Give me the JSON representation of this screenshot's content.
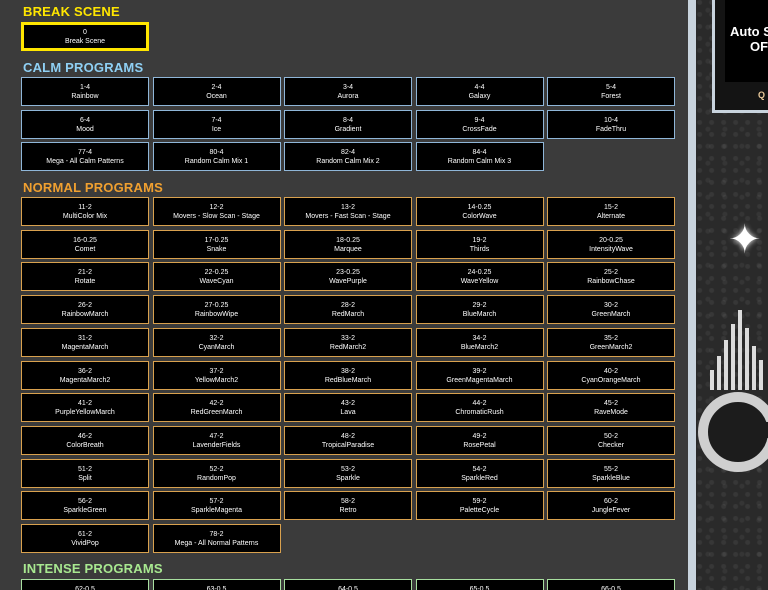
{
  "break_scene": {
    "title": "BREAK SCENE",
    "title_color": "#ffe600",
    "button": {
      "num": "0",
      "name": "Break Scene"
    }
  },
  "calm": {
    "title": "CALM PROGRAMS",
    "title_color": "#8fd0f4",
    "border_color": "#8fb6d8",
    "items": [
      {
        "num": "1-4",
        "name": "Rainbow"
      },
      {
        "num": "2-4",
        "name": "Ocean"
      },
      {
        "num": "3-4",
        "name": "Aurora"
      },
      {
        "num": "4-4",
        "name": "Galaxy"
      },
      {
        "num": "5-4",
        "name": "Forest"
      },
      {
        "num": "6-4",
        "name": "Mood"
      },
      {
        "num": "7-4",
        "name": "Ice"
      },
      {
        "num": "8-4",
        "name": "Gradient"
      },
      {
        "num": "9-4",
        "name": "CrossFade"
      },
      {
        "num": "10-4",
        "name": "FadeThru"
      },
      {
        "num": "77-4",
        "name": "Mega - All Calm Patterns"
      },
      {
        "num": "80-4",
        "name": "Random Calm Mix 1"
      },
      {
        "num": "82-4",
        "name": "Random Calm Mix 2"
      },
      {
        "num": "84-4",
        "name": "Random Calm Mix 3"
      }
    ]
  },
  "normal": {
    "title": "NORMAL PROGRAMS",
    "title_color": "#f0a030",
    "border_color": "#d9a14e",
    "items": [
      {
        "num": "11-2",
        "name": "MultiColor Mix"
      },
      {
        "num": "12-2",
        "name": "Movers - Slow Scan - Stage"
      },
      {
        "num": "13-2",
        "name": "Movers - Fast Scan - Stage"
      },
      {
        "num": "14-0.25",
        "name": "ColorWave"
      },
      {
        "num": "15-2",
        "name": "Alternate"
      },
      {
        "num": "16-0.25",
        "name": "Comet"
      },
      {
        "num": "17-0.25",
        "name": "Snake"
      },
      {
        "num": "18-0.25",
        "name": "Marquee"
      },
      {
        "num": "19-2",
        "name": "Thirds"
      },
      {
        "num": "20-0.25",
        "name": "IntensityWave"
      },
      {
        "num": "21-2",
        "name": "Rotate"
      },
      {
        "num": "22-0.25",
        "name": "WaveCyan"
      },
      {
        "num": "23-0.25",
        "name": "WavePurple"
      },
      {
        "num": "24-0.25",
        "name": "WaveYellow"
      },
      {
        "num": "25-2",
        "name": "RainbowChase"
      },
      {
        "num": "26-2",
        "name": "RainbowMarch"
      },
      {
        "num": "27-0.25",
        "name": "RainbowWipe"
      },
      {
        "num": "28-2",
        "name": "RedMarch"
      },
      {
        "num": "29-2",
        "name": "BlueMarch"
      },
      {
        "num": "30-2",
        "name": "GreenMarch"
      },
      {
        "num": "31-2",
        "name": "MagentaMarch"
      },
      {
        "num": "32-2",
        "name": "CyanMarch"
      },
      {
        "num": "33-2",
        "name": "RedMarch2"
      },
      {
        "num": "34-2",
        "name": "BlueMarch2"
      },
      {
        "num": "35-2",
        "name": "GreenMarch2"
      },
      {
        "num": "36-2",
        "name": "MagentaMarch2"
      },
      {
        "num": "37-2",
        "name": "YellowMarch2"
      },
      {
        "num": "38-2",
        "name": "RedBlueMarch"
      },
      {
        "num": "39-2",
        "name": "GreenMagentaMarch"
      },
      {
        "num": "40-2",
        "name": "CyanOrangeMarch"
      },
      {
        "num": "41-2",
        "name": "PurpleYellowMarch"
      },
      {
        "num": "42-2",
        "name": "RedGreenMarch"
      },
      {
        "num": "43-2",
        "name": "Lava"
      },
      {
        "num": "44-2",
        "name": "ChromaticRush"
      },
      {
        "num": "45-2",
        "name": "RaveMode"
      },
      {
        "num": "46-2",
        "name": "ColorBreath"
      },
      {
        "num": "47-2",
        "name": "LavenderFields"
      },
      {
        "num": "48-2",
        "name": "TropicalParadise"
      },
      {
        "num": "49-2",
        "name": "RosePetal"
      },
      {
        "num": "50-2",
        "name": "Checker"
      },
      {
        "num": "51-2",
        "name": "Split"
      },
      {
        "num": "52-2",
        "name": "RandomPop"
      },
      {
        "num": "53-2",
        "name": "Sparkle"
      },
      {
        "num": "54-2",
        "name": "SparkleRed"
      },
      {
        "num": "55-2",
        "name": "SparkleBlue"
      },
      {
        "num": "56-2",
        "name": "SparkleGreen"
      },
      {
        "num": "57-2",
        "name": "SparkleMagenta"
      },
      {
        "num": "58-2",
        "name": "Retro"
      },
      {
        "num": "59-2",
        "name": "PaletteCycle"
      },
      {
        "num": "60-2",
        "name": "JungleFever"
      },
      {
        "num": "61-2",
        "name": "VividPop"
      },
      {
        "num": "78-2",
        "name": "Mega - All Normal Patterns"
      }
    ]
  },
  "intense": {
    "title": "INTENSE PROGRAMS",
    "title_color": "#a8e890",
    "border_color": "#a8e0a0",
    "items": [
      {
        "num": "62-0.5",
        "name": ""
      },
      {
        "num": "63-0.5",
        "name": ""
      },
      {
        "num": "64-0.5",
        "name": ""
      },
      {
        "num": "65-0.5",
        "name": ""
      },
      {
        "num": "66-0.5",
        "name": ""
      }
    ]
  },
  "right_panel": {
    "auto_line1": "Auto S",
    "auto_line2": "OF",
    "q_label": "Q"
  }
}
